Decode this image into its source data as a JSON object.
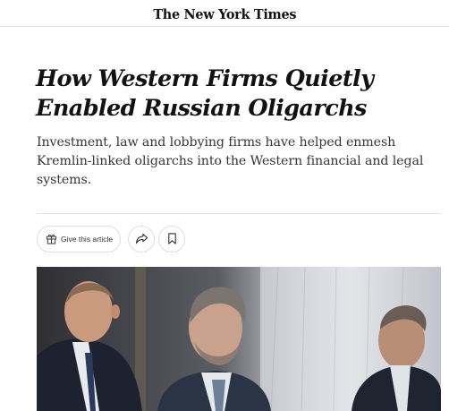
{
  "masthead": {
    "logo_text": "The New York Times"
  },
  "article": {
    "headline": "How Western Firms Quietly Enabled Russian Oligarchs",
    "summary": "Investment, law and lobbying firms have helped enmesh Kremlin-linked oligarchs into the Western financial and legal systems."
  },
  "share_bar": {
    "gift_label": "Give this article",
    "gift_icon": "gift-icon",
    "share_icon": "share-arrow-icon",
    "save_icon": "bookmark-icon"
  },
  "photo": {
    "subject": "three men in suits at an official event"
  },
  "colors": {
    "text": "#121212",
    "summary_text": "#363636",
    "border": "#dfdfdf"
  }
}
